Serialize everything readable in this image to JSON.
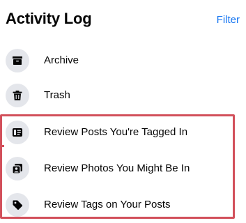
{
  "header": {
    "title": "Activity Log",
    "filter_label": "Filter"
  },
  "items": [
    {
      "label": "Archive",
      "icon": "archive-icon"
    },
    {
      "label": "Trash",
      "icon": "trash-icon"
    },
    {
      "label": "Review Posts You're Tagged In",
      "icon": "tagged-posts-icon"
    },
    {
      "label": "Review Photos You Might Be In",
      "icon": "photos-icon"
    },
    {
      "label": "Review Tags on Your Posts",
      "icon": "tag-icon"
    }
  ],
  "colors": {
    "accent": "#1877f2",
    "highlight": "#d2505b",
    "icon_bg": "#e4e6eb"
  }
}
